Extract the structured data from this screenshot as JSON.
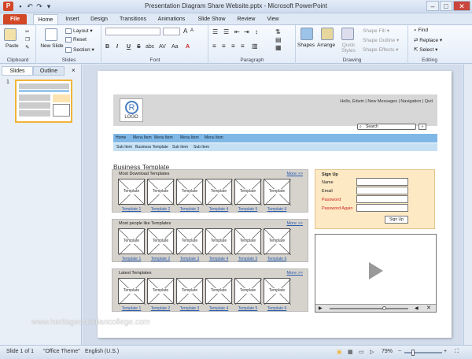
{
  "window": {
    "title": "Presentation Diagram Share Website.pptx  -  Microsoft PowerPoint",
    "app_letter": "P"
  },
  "tabs": [
    "File",
    "Home",
    "Insert",
    "Design",
    "Transitions",
    "Animations",
    "Slide Show",
    "Review",
    "View"
  ],
  "ribbon": {
    "clipboard": {
      "label": "Clipboard",
      "paste": "Paste"
    },
    "slides": {
      "label": "Slides",
      "new_slide": "New Slide",
      "layout": "Layout ▾",
      "reset": "Reset",
      "section": "Section ▾"
    },
    "font": {
      "label": "Font",
      "bold": "B",
      "italic": "I",
      "underline": "U",
      "strike": "S",
      "shadow": "abc",
      "spacing": "AV",
      "case": "Aa",
      "color": "A"
    },
    "paragraph": {
      "label": "Paragraph"
    },
    "drawing": {
      "label": "Drawing",
      "shapes": "Shapes",
      "arrange": "Arrange",
      "quick_styles": "Quick Styles",
      "shape_fill": "Shape Fill ▾",
      "shape_outline": "Shape Outline ▾",
      "shape_effects": "Shape Effects ▾"
    },
    "editing": {
      "label": "Editing",
      "find": "Find",
      "replace": "Replace ▾",
      "select": "Select ▾"
    }
  },
  "pane": {
    "tab_slides": "Slides",
    "tab_outline": "Outline",
    "close": "×",
    "slide_number": "1"
  },
  "slide": {
    "logo_text": "LOGO",
    "logo_symbol": "R",
    "top_links": "Hello, Edwin  |  New Messages  |  Navigation  |  Quit",
    "search_placeholder": "Search",
    "menu": [
      "Home",
      "Menu Item",
      "Menu Item",
      "Menu Item",
      "Menu Item"
    ],
    "submenu": [
      "Sub Item",
      "Business Template",
      "Sub Item",
      "Sub Item"
    ],
    "business_title": "Business Template",
    "panels": [
      {
        "title": "Most Download  Templates",
        "more": "More >>"
      },
      {
        "title": "Most people  like  Templates",
        "more": "More >>"
      },
      {
        "title": "Latest  Templates",
        "more": "More >>"
      }
    ],
    "template_label": "Template",
    "template_links": [
      "Template  1",
      "Template  2",
      "Template  3",
      "Template  4",
      "Template  5",
      "Template  6"
    ],
    "signup": {
      "title": "Sign Up",
      "fields": [
        "Name",
        "Email",
        "Password",
        "Password  Again"
      ],
      "button": "Sign Up"
    }
  },
  "status": {
    "slide": "Slide 1 of 1",
    "theme": "\"Office Theme\"",
    "language": "English (U.S.)",
    "zoom": "79%"
  },
  "watermark": "www.heritagechristiancollege.com"
}
